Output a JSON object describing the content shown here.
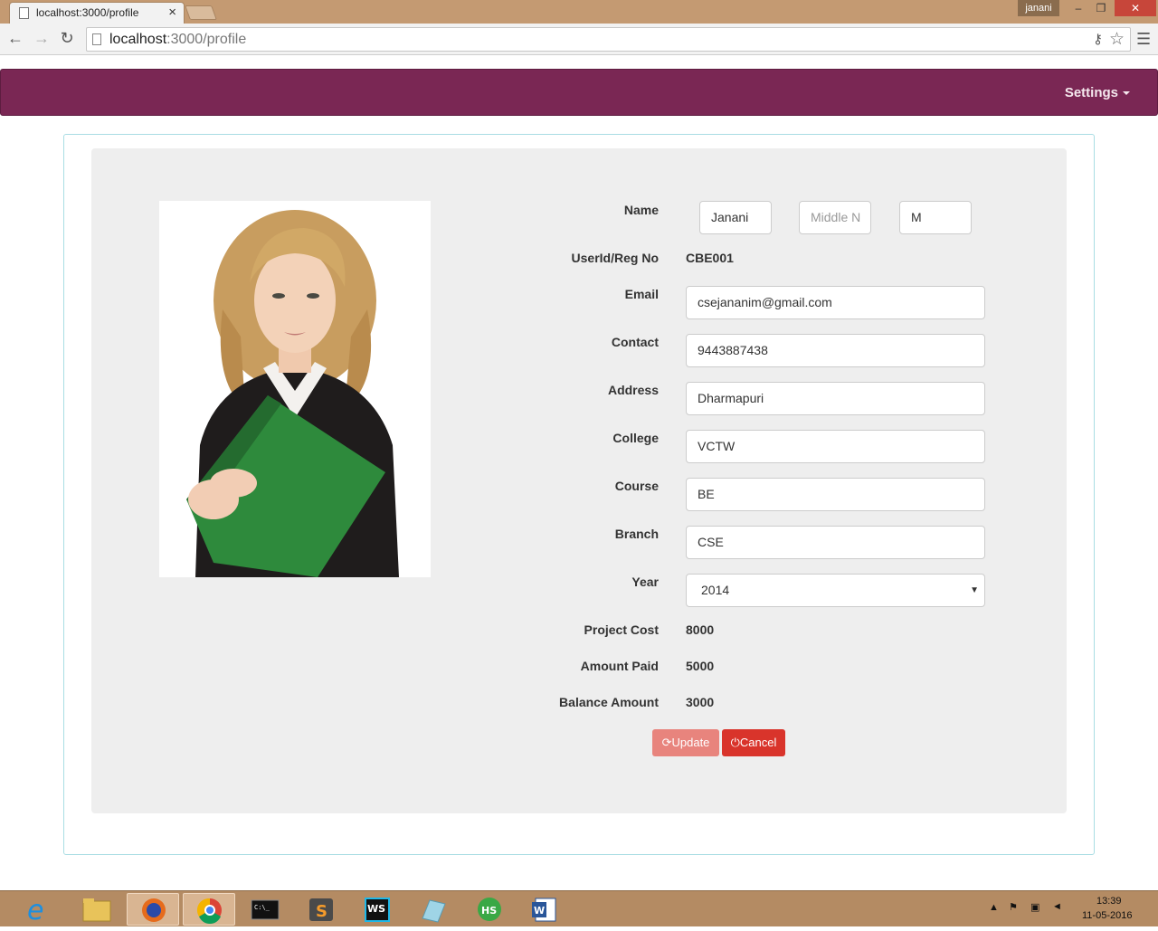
{
  "browser": {
    "tab_title": "localhost:3000/profile",
    "url_host": "localhost",
    "url_path": ":3000/profile",
    "user": "janani"
  },
  "navbar": {
    "settings_label": "Settings"
  },
  "profile": {
    "labels": {
      "name": "Name",
      "userid": "UserId/Reg No",
      "email": "Email",
      "contact": "Contact",
      "address": "Address",
      "college": "College",
      "course": "Course",
      "branch": "Branch",
      "year": "Year",
      "project_cost": "Project Cost",
      "amount_paid": "Amount Paid",
      "balance_amount": "Balance Amount"
    },
    "first_name": "Janani",
    "middle_name_placeholder": "Middle N",
    "last_name": "M",
    "userid": "CBE001",
    "email": "csejananim@gmail.com",
    "contact": "9443887438",
    "address": "Dharmapuri",
    "college": "VCTW",
    "course": "BE",
    "branch": "CSE",
    "year": "2014",
    "project_cost": "8000",
    "amount_paid": "5000",
    "balance_amount": "3000"
  },
  "buttons": {
    "update": "Update",
    "cancel": "Cancel"
  },
  "taskbar": {
    "time": "13:39",
    "date": "11-05-2016"
  }
}
